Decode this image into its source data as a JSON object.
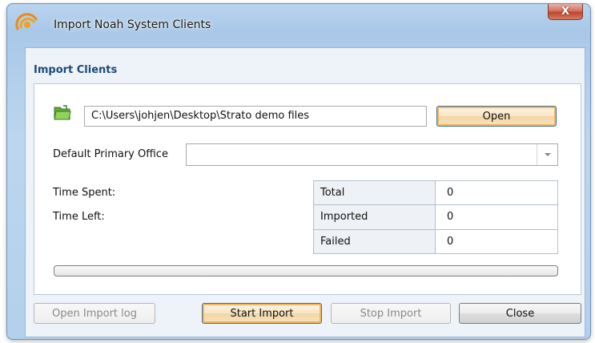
{
  "window": {
    "title": "Import Noah System Clients",
    "close_glyph": "X"
  },
  "group": {
    "title": "Import Clients"
  },
  "file": {
    "path": "C:\\Users\\johjen\\Desktop\\Strato demo files",
    "open_label": "Open"
  },
  "office": {
    "label": "Default Primary Office",
    "value": ""
  },
  "time": {
    "spent_label": "Time Spent:",
    "left_label": "Time Left:"
  },
  "stats": [
    {
      "label": "Total",
      "value": "0"
    },
    {
      "label": "Imported",
      "value": "0"
    },
    {
      "label": "Failed",
      "value": "0"
    }
  ],
  "progress": {
    "percent": 0
  },
  "buttons": {
    "open_log": "Open Import log",
    "start": "Start Import",
    "stop": "Stop Import",
    "close": "Close"
  },
  "icons": {
    "app": "noah-swirl-icon",
    "folder": "folder-open-icon",
    "combo_arrow": "chevron-down-icon"
  },
  "colors": {
    "accent_title": "#1d4a7a",
    "default_button_glow": "#f2b65c",
    "close_button": "#c0452c"
  }
}
